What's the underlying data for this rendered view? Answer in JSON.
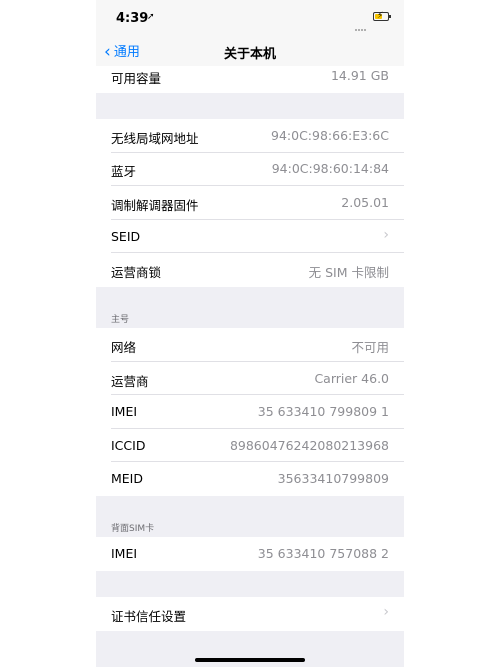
{
  "status": {
    "time": "4:39",
    "location_icon": "location-arrow-icon"
  },
  "nav": {
    "back_label": "通用",
    "title": "关于本机"
  },
  "capacity": {
    "label": "可用容量",
    "value": "14.91 GB"
  },
  "group1": [
    {
      "label": "无线局域网地址",
      "value": "94:0C:98:66:E3:6C"
    },
    {
      "label": "蓝牙",
      "value": "94:0C:98:60:14:84"
    },
    {
      "label": "调制解调器固件",
      "value": "2.05.01"
    },
    {
      "label": "SEID",
      "value": ""
    },
    {
      "label": "运营商锁",
      "value": "无 SIM 卡限制"
    }
  ],
  "primary": {
    "header": "主号",
    "rows": [
      {
        "label": "网络",
        "value": "不可用"
      },
      {
        "label": "运营商",
        "value": "Carrier 46.0"
      },
      {
        "label": "IMEI",
        "value": "35 633410 799809 1"
      },
      {
        "label": "ICCID",
        "value": "89860476242080213968"
      },
      {
        "label": "MEID",
        "value": "35633410799809"
      }
    ]
  },
  "back_sim": {
    "header": "背面SIM卡",
    "rows": [
      {
        "label": "IMEI",
        "value": "35 633410 757088 2"
      }
    ]
  },
  "cert": {
    "label": "证书信任设置"
  }
}
